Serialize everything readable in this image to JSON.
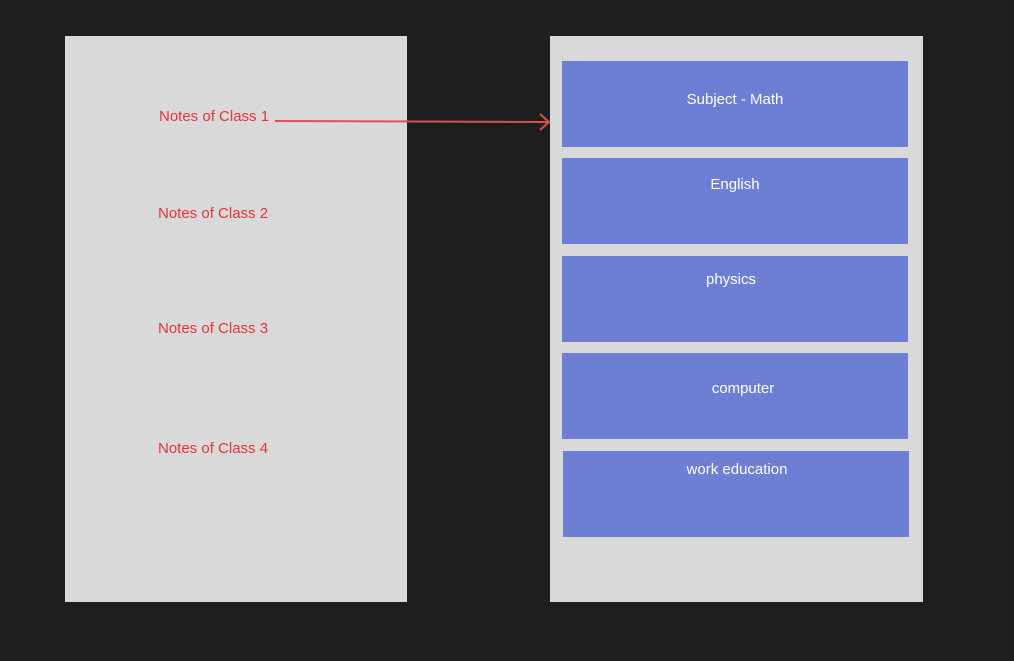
{
  "classes": [
    {
      "label": "Notes of Class 1"
    },
    {
      "label": "Notes of Class 2"
    },
    {
      "label": "Notes of Class 3"
    },
    {
      "label": "Notes of Class 4"
    }
  ],
  "subjects": [
    {
      "label": "Subject - Math"
    },
    {
      "label": "English"
    },
    {
      "label": "physics"
    },
    {
      "label": "computer"
    },
    {
      "label": "work education"
    }
  ],
  "colors": {
    "background": "#1e1e1e",
    "panel": "#d9d9d9",
    "class_text": "#e5343b",
    "card": "#6d7ed5",
    "card_text": "#ffffff",
    "arrow": "#d9534f"
  }
}
